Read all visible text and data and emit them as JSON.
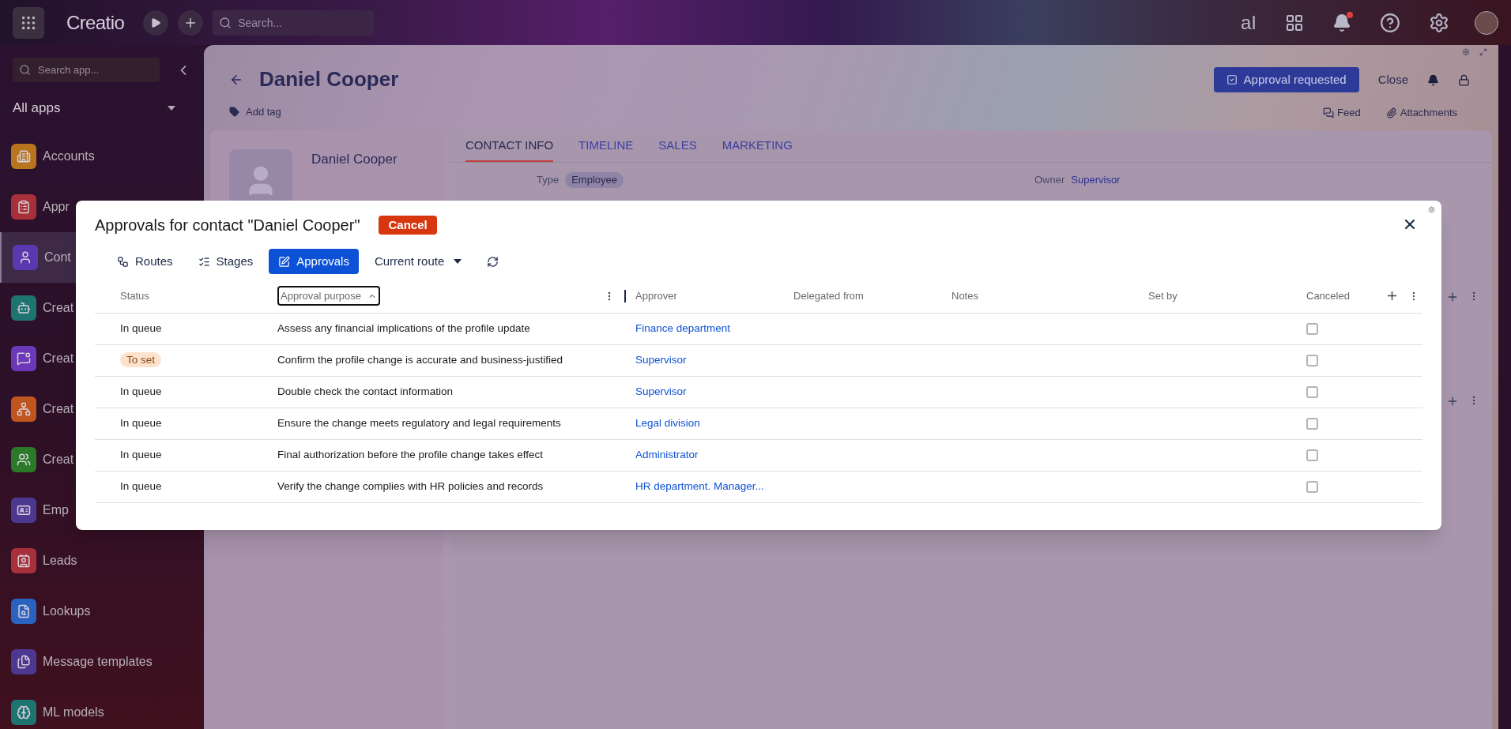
{
  "topbar": {
    "logo": "Creatio",
    "search_placeholder": "Search...",
    "ai_label": "aI",
    "has_notification": true
  },
  "sidebar": {
    "search_placeholder": "Search app...",
    "group": "All apps",
    "items": [
      {
        "label": "Accounts",
        "color": "#b9741f",
        "selected": false
      },
      {
        "label": "Appr",
        "color": "#a8303a",
        "selected": false
      },
      {
        "label": "Cont",
        "color": "#5a38b0",
        "selected": true
      },
      {
        "label": "Creat",
        "color": "#1e7470",
        "selected": false
      },
      {
        "label": "Creat",
        "color": "#6a38b8",
        "selected": false
      },
      {
        "label": "Creat",
        "color": "#c0561f",
        "selected": false
      },
      {
        "label": "Creat",
        "color": "#2a7a2a",
        "selected": false
      },
      {
        "label": "Emp",
        "color": "#4c3890",
        "selected": false
      },
      {
        "label": "Leads",
        "color": "#a8303a",
        "selected": false
      },
      {
        "label": "Lookups",
        "color": "#2a62c0",
        "selected": false
      },
      {
        "label": "Message templates",
        "color": "#4c3890",
        "selected": false
      },
      {
        "label": "ML models",
        "color": "#1e7470",
        "selected": false
      }
    ]
  },
  "record": {
    "title": "Daniel Cooper",
    "add_tag": "Add tag",
    "primary_button": "Approval requested",
    "close_button": "Close",
    "feed": "Feed",
    "attachments": "Attachments",
    "profile_name": "Daniel Cooper",
    "tabs": [
      {
        "label": "CONTACT INFO",
        "selected": true
      },
      {
        "label": "TIMELINE",
        "selected": false
      },
      {
        "label": "SALES",
        "selected": false
      },
      {
        "label": "MARKETING",
        "selected": false
      }
    ],
    "fields": [
      {
        "label": "Type",
        "value": "Employee",
        "kind": "chip"
      },
      {
        "label": "Owner",
        "value": "Supervisor",
        "kind": "link"
      }
    ]
  },
  "dialog": {
    "title": "Approvals for contact \"Daniel Cooper\"",
    "cancel": "Cancel",
    "tabs": [
      {
        "label": "Routes",
        "selected": false
      },
      {
        "label": "Stages",
        "selected": false
      },
      {
        "label": "Approvals",
        "selected": true
      }
    ],
    "route_dropdown": "Current route",
    "columns": [
      "Status",
      "Approval purpose",
      "Approver",
      "Delegated from",
      "Notes",
      "Set by",
      "Canceled"
    ],
    "rows": [
      {
        "status": "In queue",
        "kind": "plain",
        "purpose": "Assess any financial implications of the profile update",
        "approver": "Finance department",
        "canceled": false
      },
      {
        "status": "To set",
        "kind": "badge",
        "purpose": "Confirm the profile change is accurate and business-justified",
        "approver": "Supervisor",
        "canceled": false
      },
      {
        "status": "In queue",
        "kind": "plain",
        "purpose": "Double check the contact information",
        "approver": "Supervisor",
        "canceled": false
      },
      {
        "status": "In queue",
        "kind": "plain",
        "purpose": "Ensure the change meets regulatory and legal requirements",
        "approver": "Legal division",
        "canceled": false
      },
      {
        "status": "In queue",
        "kind": "plain",
        "purpose": "Final authorization before the profile change takes effect",
        "approver": "Administrator",
        "canceled": false
      },
      {
        "status": "In queue",
        "kind": "plain",
        "purpose": "Verify the change complies with HR policies and records",
        "approver": "HR department. Manager...",
        "canceled": false
      }
    ]
  }
}
